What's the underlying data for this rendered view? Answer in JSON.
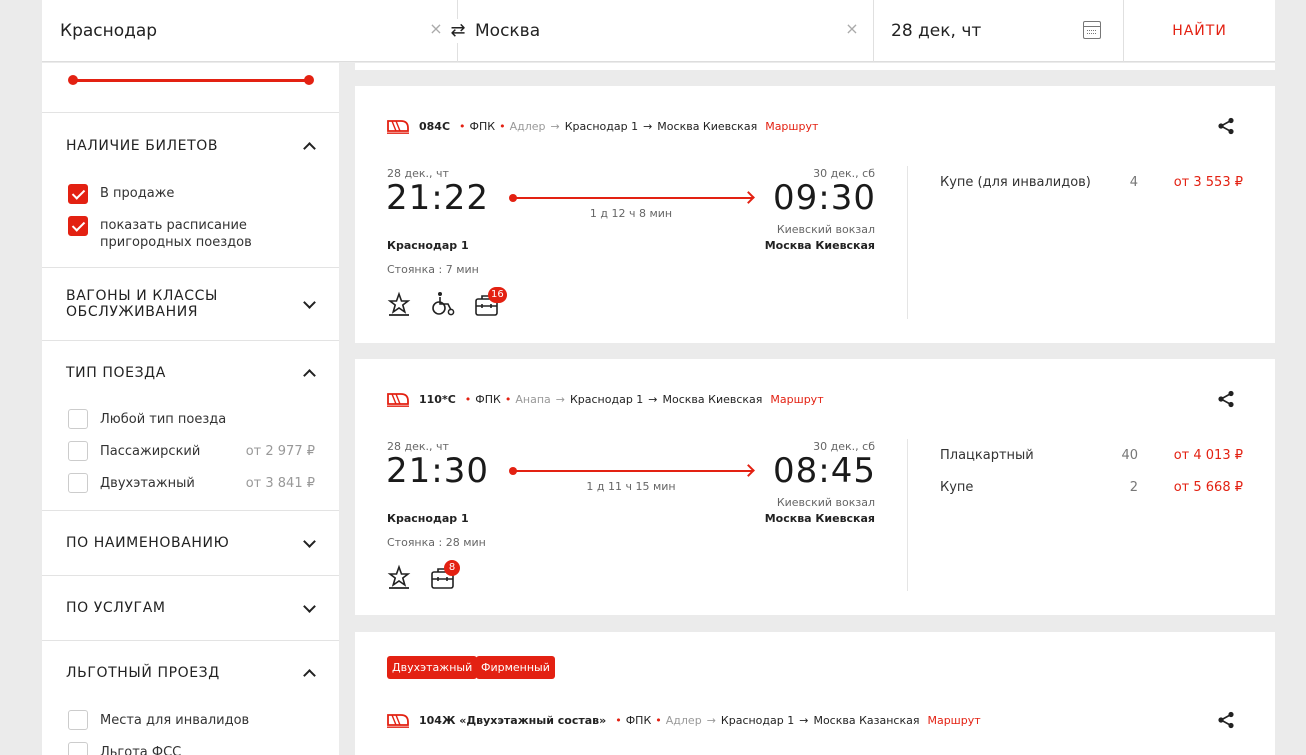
{
  "search": {
    "from": "Краснодар",
    "to": "Москва",
    "date": "28 дек, чт",
    "find_label": "НАЙТИ",
    "clear": "×",
    "swap": "⇄"
  },
  "filters": {
    "availability": {
      "title": "НАЛИЧИЕ БИЛЕТОВ",
      "items": [
        {
          "label": "В продаже",
          "checked": true
        },
        {
          "label_line1": "показать расписание",
          "label_line2": "пригородных поездов",
          "checked": true
        }
      ]
    },
    "wagons": {
      "line1": "ВАГОНЫ И КЛАССЫ",
      "line2": "ОБСЛУЖИВАНИЯ"
    },
    "train_type": {
      "title": "ТИП ПОЕЗДА",
      "items": [
        {
          "label": "Любой тип поезда",
          "price": ""
        },
        {
          "label": "Пассажирский",
          "price": "от 2 977 ₽"
        },
        {
          "label": "Двухэтажный",
          "price": "от 3 841 ₽"
        }
      ]
    },
    "by_name": "ПО НАИМЕНОВАНИЮ",
    "by_services": "ПО УСЛУГАМ",
    "benefit": {
      "title": "ЛЬГОТНЫЙ ПРОЕЗД",
      "items": [
        {
          "label": "Места для инвалидов"
        },
        {
          "label": "Льгота ФСС"
        }
      ]
    }
  },
  "trains": [
    {
      "number": "084С",
      "carrier": "ФПК",
      "origin": "Адлер",
      "from": "Краснодар 1",
      "to": "Москва Киевская",
      "route_link": "Маршрут",
      "dep_date": "28 дек., чт",
      "dep_time": "21:22",
      "arr_date": "30 дек., сб",
      "arr_time": "09:30",
      "duration": "1 д 12 ч 8 мин",
      "dep_station": "Краснодар 1",
      "arr_vokzal": "Киевский вокзал",
      "arr_station": "Москва Киевская",
      "stop": "Стоянка : 7 мин",
      "badge": "16",
      "classes": [
        {
          "name": "Купе (для инвалидов)",
          "count": "4",
          "price": "от 3 553 ₽"
        }
      ]
    },
    {
      "number": "110*С",
      "carrier": "ФПК",
      "origin": "Анапа",
      "from": "Краснодар 1",
      "to": "Москва Киевская",
      "route_link": "Маршрут",
      "dep_date": "28 дек., чт",
      "dep_time": "21:30",
      "arr_date": "30 дек., сб",
      "arr_time": "08:45",
      "duration": "1 д 11 ч 15 мин",
      "dep_station": "Краснодар 1",
      "arr_vokzal": "Киевский вокзал",
      "arr_station": "Москва Киевская",
      "stop": "Стоянка : 28 мин",
      "badge": "8",
      "classes": [
        {
          "name": "Плацкартный",
          "count": "40",
          "price": "от 4 013 ₽"
        },
        {
          "name": "Купе",
          "count": "2",
          "price": "от 5 668 ₽"
        }
      ]
    },
    {
      "tags": [
        "Двухэтажный",
        "Фирменный"
      ],
      "number": "104Ж «Двухэтажный состав»",
      "carrier": "ФПК",
      "origin": "Адлер",
      "from": "Краснодар 1",
      "to": "Москва Казанская",
      "route_link": "Маршрут"
    }
  ],
  "colors": {
    "accent": "#e32112",
    "background": "#ebebeb"
  }
}
